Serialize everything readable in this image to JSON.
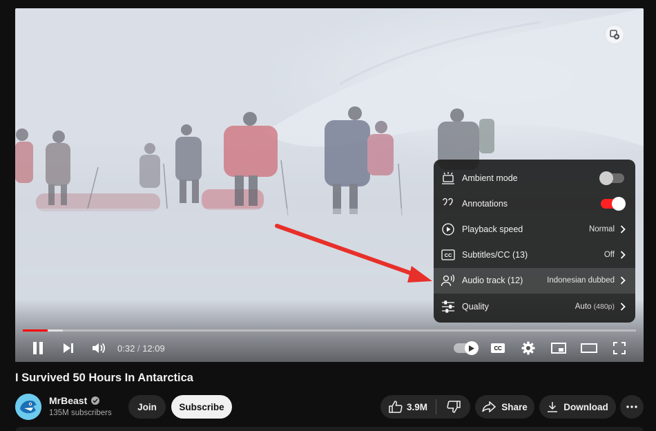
{
  "video": {
    "current_time": "0:32",
    "time_separator": "/",
    "duration": "12:09",
    "progress_fraction": 0.04,
    "buffered_fraction": 0.065
  },
  "settings_menu": {
    "items": [
      {
        "label": "Ambient mode",
        "icon": "ambient-mode-icon",
        "type": "toggle",
        "state": "off"
      },
      {
        "label": "Annotations",
        "icon": "annotations-icon",
        "type": "toggle",
        "state": "on"
      },
      {
        "label": "Playback speed",
        "icon": "playback-speed-icon",
        "type": "submenu",
        "value": "Normal",
        "value_suffix": ""
      },
      {
        "label": "Subtitles/CC (13)",
        "icon": "subtitles-icon",
        "type": "submenu",
        "value": "Off",
        "value_suffix": ""
      },
      {
        "label": "Audio track (12)",
        "icon": "audio-track-icon",
        "type": "submenu",
        "value": "Indonesian dubbed",
        "value_suffix": ""
      },
      {
        "label": "Quality",
        "icon": "quality-icon",
        "type": "submenu",
        "value": "Auto",
        "value_suffix": "(480p)"
      }
    ]
  },
  "controls": {
    "cc_label": "CC"
  },
  "video_title": "I Survived 50 Hours In Antarctica",
  "channel": {
    "name": "MrBeast",
    "subscribers": "135M subscribers"
  },
  "actions": {
    "join": "Join",
    "subscribe": "Subscribe",
    "likes": "3.9M",
    "share": "Share",
    "download": "Download"
  },
  "colors": {
    "accent_red": "#ff0000",
    "toggle_on": "#ff2222",
    "page_background": "#0f0f0f",
    "annotation_arrow": "#e8302a"
  }
}
